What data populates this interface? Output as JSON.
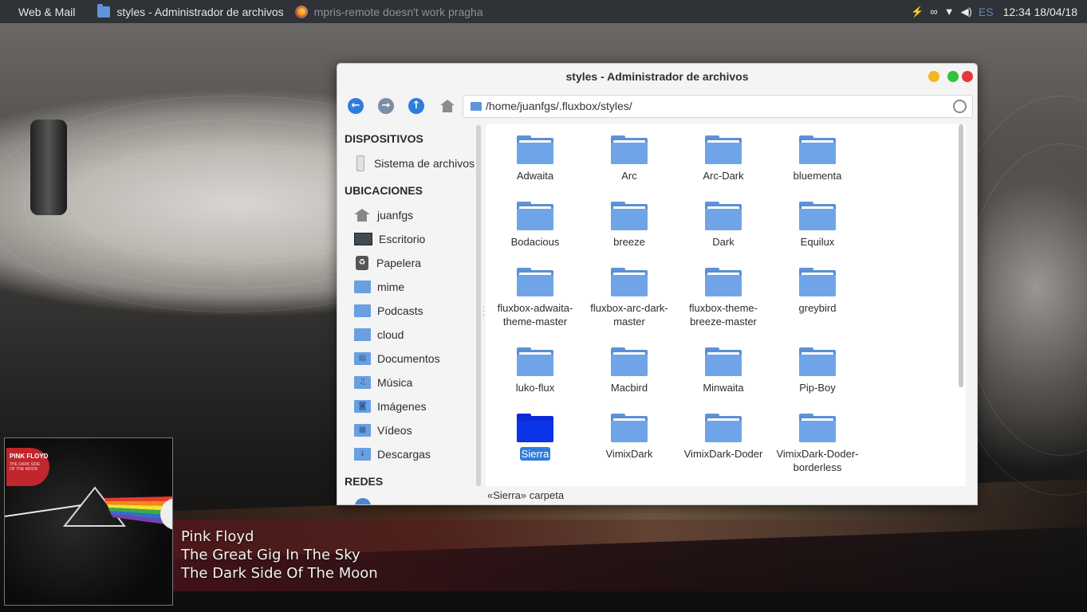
{
  "panel": {
    "tasks": [
      {
        "label": "Web & Mail",
        "icon": ""
      },
      {
        "label": "styles - Administrador de archivos",
        "icon": "folder-icon"
      },
      {
        "label": "mpris-remote doesn't work pragha",
        "icon": "firefox-icon"
      }
    ],
    "tray": {
      "icons": [
        "battery-icon",
        "network-link-icon",
        "wifi-icon",
        "volume-icon"
      ],
      "lang": "ES",
      "clock": "12:34 18/04/18"
    }
  },
  "window": {
    "title": "styles - Administrador de archivos",
    "location": "/home/juanfgs/.fluxbox/styles/",
    "status": "«Sierra» carpeta",
    "sidebar": {
      "sections": [
        {
          "title": "DISPOSITIVOS",
          "items": [
            {
              "label": "Sistema de archivos",
              "icon": "drive-icon"
            }
          ]
        },
        {
          "title": "UBICACIONES",
          "items": [
            {
              "label": "juanfgs",
              "icon": "home-icon"
            },
            {
              "label": "Escritorio",
              "icon": "desktop-icon"
            },
            {
              "label": "Papelera",
              "icon": "trash-icon"
            },
            {
              "label": "mime",
              "icon": "folder-icon"
            },
            {
              "label": "Podcasts",
              "icon": "folder-icon"
            },
            {
              "label": "cloud",
              "icon": "folder-icon"
            },
            {
              "label": "Documentos",
              "icon": "documents-folder-icon"
            },
            {
              "label": "Música",
              "icon": "music-folder-icon"
            },
            {
              "label": "Imágenes",
              "icon": "pictures-folder-icon"
            },
            {
              "label": "Vídeos",
              "icon": "videos-folder-icon"
            },
            {
              "label": "Descargas",
              "icon": "downloads-folder-icon"
            }
          ]
        },
        {
          "title": "REDES",
          "items": []
        }
      ]
    },
    "folders": [
      [
        "Adwaita"
      ],
      [
        "Arc"
      ],
      [
        "Arc-Dark"
      ],
      [
        "bluementa"
      ],
      [
        "Bodacious"
      ],
      [
        "breeze"
      ],
      [
        "Dark"
      ],
      [
        "Equilux"
      ],
      [
        "fluxbox-adwaita-",
        "theme-master"
      ],
      [
        "fluxbox-arc-dark-",
        "master"
      ],
      [
        "fluxbox-theme-",
        "breeze-master"
      ],
      [
        "greybird"
      ],
      [
        "luko-flux"
      ],
      [
        "Macbird"
      ],
      [
        "Minwaita"
      ],
      [
        "Pip-Boy"
      ],
      [
        "Sierra"
      ],
      [
        "VimixDark"
      ],
      [
        "VimixDark-Doder"
      ],
      [
        "VimixDark-Doder-",
        "borderless"
      ]
    ],
    "selected_folder": "Sierra",
    "colors": {
      "folder": "#6fa5e8",
      "selected_folder": "#0a35e8",
      "selection": "#2f7ddb",
      "accent_close": "#e8353b",
      "accent_min": "#f4b621",
      "accent_max": "#2fc33e"
    }
  },
  "now_playing": {
    "artist": "Pink Floyd",
    "track": "The Great Gig In The Sky",
    "album": "The Dark Side Of The Moon",
    "cover": {
      "band": "PINK FLOYD",
      "subtitle": "THE DARK SIDE OF THE MOON"
    }
  }
}
